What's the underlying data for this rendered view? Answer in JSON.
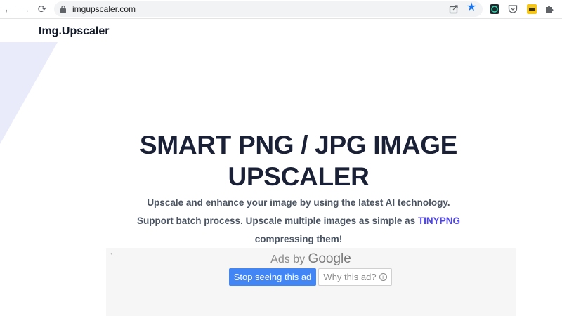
{
  "browser": {
    "url": "imgupscaler.com",
    "back_glyph": "←",
    "forward_glyph": "→",
    "reload_glyph": "⟳",
    "star_glyph": "★",
    "accent": "#1a73e8",
    "icons": [
      "back-arrow-icon",
      "forward-arrow-icon",
      "reload-icon",
      "lock-icon",
      "share-icon",
      "bookmark-star-icon",
      "extension-icon",
      "pocket-icon",
      "extension-icon",
      "puzzle-icon"
    ]
  },
  "site": {
    "logo": "Img.Upscaler"
  },
  "hero": {
    "title_line1": "SMART PNG / JPG IMAGE",
    "title_line2": "UPSCALER",
    "sub_line1": "Upscale and enhance your image by using the latest AI technology.",
    "sub_line2_prefix": "Support batch process. Upscale multiple images as simple as ",
    "sub_line2_link": "TINYPNG",
    "sub_line3": "compressing them!",
    "link_color": "#4f46e5"
  },
  "ad": {
    "ads_by": "Ads by",
    "google": "Google",
    "stop_label": "Stop seeing this ad",
    "why_label": "Why this ad?",
    "info_glyph": "i",
    "back_glyph": "←",
    "button_color": "#4285f4"
  }
}
